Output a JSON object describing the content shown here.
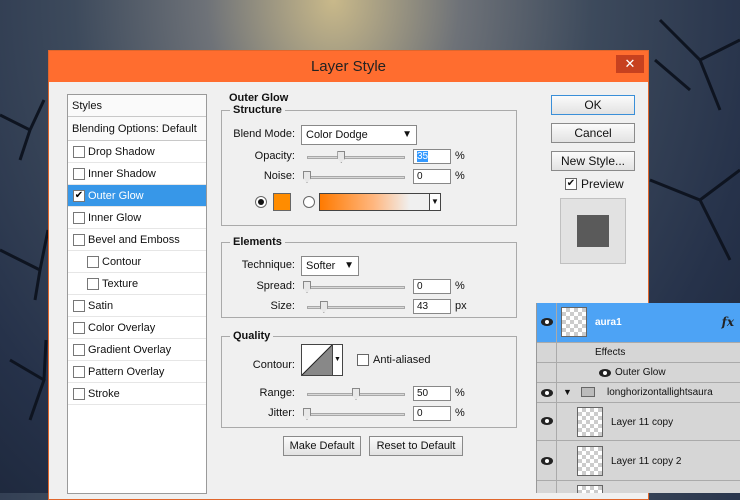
{
  "dialog": {
    "title": "Layer Style",
    "close_glyph": "✕"
  },
  "styles_list": {
    "header": "Styles",
    "blending": "Blending Options: Default",
    "items": [
      {
        "label": "Drop Shadow",
        "checked": false,
        "sub": false,
        "selected": false
      },
      {
        "label": "Inner Shadow",
        "checked": false,
        "sub": false,
        "selected": false
      },
      {
        "label": "Outer Glow",
        "checked": true,
        "sub": false,
        "selected": true
      },
      {
        "label": "Inner Glow",
        "checked": false,
        "sub": false,
        "selected": false
      },
      {
        "label": "Bevel and Emboss",
        "checked": false,
        "sub": false,
        "selected": false
      },
      {
        "label": "Contour",
        "checked": false,
        "sub": true,
        "selected": false
      },
      {
        "label": "Texture",
        "checked": false,
        "sub": true,
        "selected": false
      },
      {
        "label": "Satin",
        "checked": false,
        "sub": false,
        "selected": false
      },
      {
        "label": "Color Overlay",
        "checked": false,
        "sub": false,
        "selected": false
      },
      {
        "label": "Gradient Overlay",
        "checked": false,
        "sub": false,
        "selected": false
      },
      {
        "label": "Pattern Overlay",
        "checked": false,
        "sub": false,
        "selected": false
      },
      {
        "label": "Stroke",
        "checked": false,
        "sub": false,
        "selected": false
      }
    ]
  },
  "outer_glow": {
    "title": "Outer Glow",
    "structure": {
      "legend": "Structure",
      "blend_mode_label": "Blend Mode:",
      "blend_mode_value": "Color Dodge",
      "opacity_label": "Opacity:",
      "opacity_value": "35",
      "noise_label": "Noise:",
      "noise_value": "0",
      "unit_percent": "%",
      "glow_color": "#ff8c00"
    },
    "elements": {
      "legend": "Elements",
      "technique_label": "Technique:",
      "technique_value": "Softer",
      "spread_label": "Spread:",
      "spread_value": "0",
      "size_label": "Size:",
      "size_value": "43",
      "unit_percent": "%",
      "unit_px": "px"
    },
    "quality": {
      "legend": "Quality",
      "contour_label": "Contour:",
      "anti_aliased_label": "Anti-aliased",
      "range_label": "Range:",
      "range_value": "50",
      "jitter_label": "Jitter:",
      "jitter_value": "0",
      "unit_percent": "%"
    },
    "make_default": "Make Default",
    "reset_default": "Reset to Default"
  },
  "buttons": {
    "ok": "OK",
    "cancel": "Cancel",
    "new_style": "New Style...",
    "preview_label": "Preview"
  },
  "layers": {
    "rows": [
      {
        "name": "aura1",
        "fx": "fx"
      },
      {
        "name": "Effects"
      },
      {
        "name": "Outer Glow"
      },
      {
        "name": "longhorizontallightsaura"
      },
      {
        "name": "Layer 11 copy"
      },
      {
        "name": "Layer 11 copy 2"
      }
    ]
  },
  "colors": {
    "titlebar": "#ff6d2f",
    "selection": "#3797e8",
    "layer_selected": "#4da3f5"
  }
}
